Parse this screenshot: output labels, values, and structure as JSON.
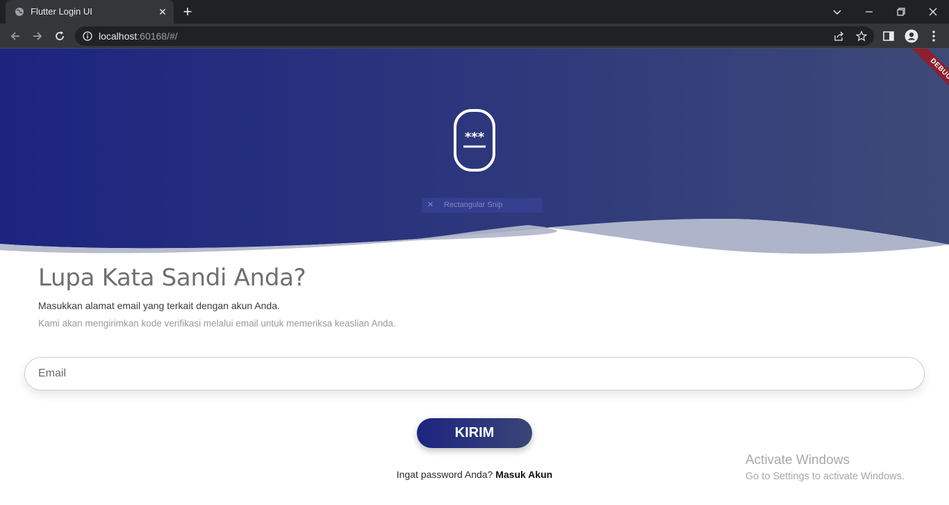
{
  "browser": {
    "tab_title": "Flutter Login UI",
    "url_host": "localhost",
    "url_rest": ":60168/#/"
  },
  "overlay": {
    "snip_label": "Rectangular Snip",
    "debug_label": "DEBUG"
  },
  "page": {
    "heading": "Lupa Kata Sandi Anda?",
    "subheading": "Masukkan alamat email yang terkait dengan akun Anda.",
    "description": "Kami akan mengirimkan kode verifikasi melalui email untuk memeriksa keaslian Anda.",
    "email_placeholder": "Email",
    "submit_label": "KIRIM",
    "footer_prompt": "Ingat password Anda?",
    "footer_link": "Masuk Akun"
  },
  "watermark": {
    "title": "Activate Windows",
    "subtitle": "Go to Settings to activate Windows."
  },
  "colors": {
    "hero_start": "#1c2480",
    "hero_end": "#3d4a78",
    "button_start": "#1c2480",
    "button_end": "#3a4576"
  }
}
